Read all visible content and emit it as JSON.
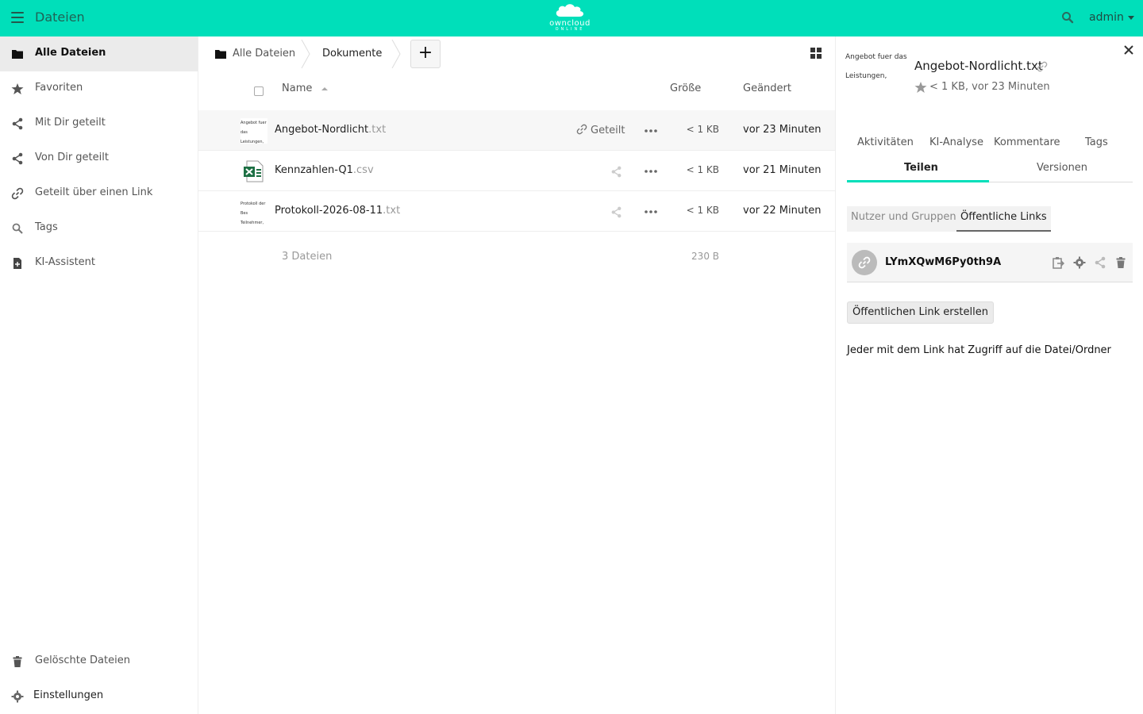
{
  "app": {
    "title": "Dateien"
  },
  "logo": {
    "word": "owncloud",
    "sub": "ONLINE"
  },
  "user": {
    "name": "admin"
  },
  "sidebar": {
    "items": [
      {
        "label": "Alle Dateien",
        "icon": "folder-icon",
        "active": true
      },
      {
        "label": "Favoriten",
        "icon": "star-icon"
      },
      {
        "label": "Mit Dir geteilt",
        "icon": "share-icon"
      },
      {
        "label": "Von Dir geteilt",
        "icon": "share-icon"
      },
      {
        "label": "Geteilt über einen Link",
        "icon": "link-icon"
      },
      {
        "label": "Tags",
        "icon": "tag-search-icon"
      },
      {
        "label": "KI-Assistent",
        "icon": "ai-file-icon"
      }
    ],
    "bottom": [
      {
        "label": "Gelöschte Dateien",
        "icon": "trash-icon"
      },
      {
        "label": "Einstellungen",
        "icon": "gear-icon"
      }
    ]
  },
  "breadcrumb": {
    "root": "Alle Dateien",
    "current": "Dokumente",
    "add_label": "+"
  },
  "table": {
    "headers": {
      "name": "Name",
      "size": "Größe",
      "modified": "Geändert"
    },
    "rows": [
      {
        "base": "Angebot-Nordlicht",
        "ext": ".txt",
        "share_label": "Geteilt",
        "size": "< 1 KB",
        "modified": "vor 23 Minuten",
        "thumb": [
          "Angebot fuer das",
          "Leistungen, Zeitp"
        ]
      },
      {
        "base": "Kennzahlen-Q1",
        "ext": ".csv",
        "size": "< 1 KB",
        "modified": "vor 21 Minuten",
        "icon": "spreadsheet-icon"
      },
      {
        "base": "Protokoll-2026-08-11",
        "ext": ".txt",
        "size": "< 1 KB",
        "modified": "vor 22 Minuten",
        "thumb": [
          "Protokoll der Bes",
          "Teilnehmer, Besc"
        ]
      }
    ],
    "summary": {
      "count": "3 Dateien",
      "size": "230 B"
    }
  },
  "details": {
    "thumb": [
      "Angebot fuer das",
      "Leistungen, Zeitp"
    ],
    "title": "Angebot-Nordlicht.txt",
    "meta": "< 1 KB, vor 23 Minuten",
    "tabs": [
      "Aktivitäten",
      "KI-Analyse",
      "Kommentare",
      "Tags",
      "Teilen",
      "Versionen"
    ],
    "subtabs": [
      "Nutzer und Gruppen",
      "Öffentliche Links"
    ],
    "link_token": "LYmXQwM6Py0th9A",
    "create_button": "Öffentlichen Link erstellen",
    "info": "Jeder mit dem Link hat Zugriff auf die Datei/Ordner"
  },
  "colors": {
    "accent": "#00dfba",
    "excel": "#1d7044"
  }
}
